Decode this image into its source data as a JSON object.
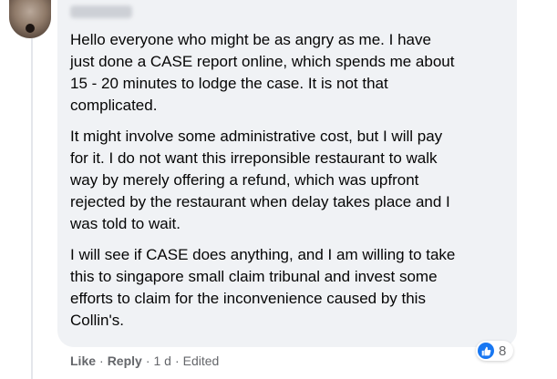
{
  "comment": {
    "paragraphs": [
      "Hello everyone who might be as angry as me. I have\njust done a CASE report online, which spends me about\n15 - 20 minutes to lodge the case. It is not that\ncomplicated.",
      "It might involve some administrative cost, but I will pay\nfor it. I do not want this irreponsible restaurant to walk\nway by merely offering a refund, which was upfront\nrejected by the restaurant when delay takes place and I\nwas told to wait.",
      "I will see if CASE does anything, and I am willing to take\nthis to singapore small claim tribunal and invest some\nefforts to claim for the inconvenience caused by this\nCollin's."
    ]
  },
  "actions": {
    "like": "Like",
    "reply": "Reply",
    "time": "1 d",
    "edited": "Edited",
    "separator": "·"
  },
  "reactions": {
    "icon": "thumbs-up-icon",
    "count": "8",
    "color": "#1877f2"
  }
}
